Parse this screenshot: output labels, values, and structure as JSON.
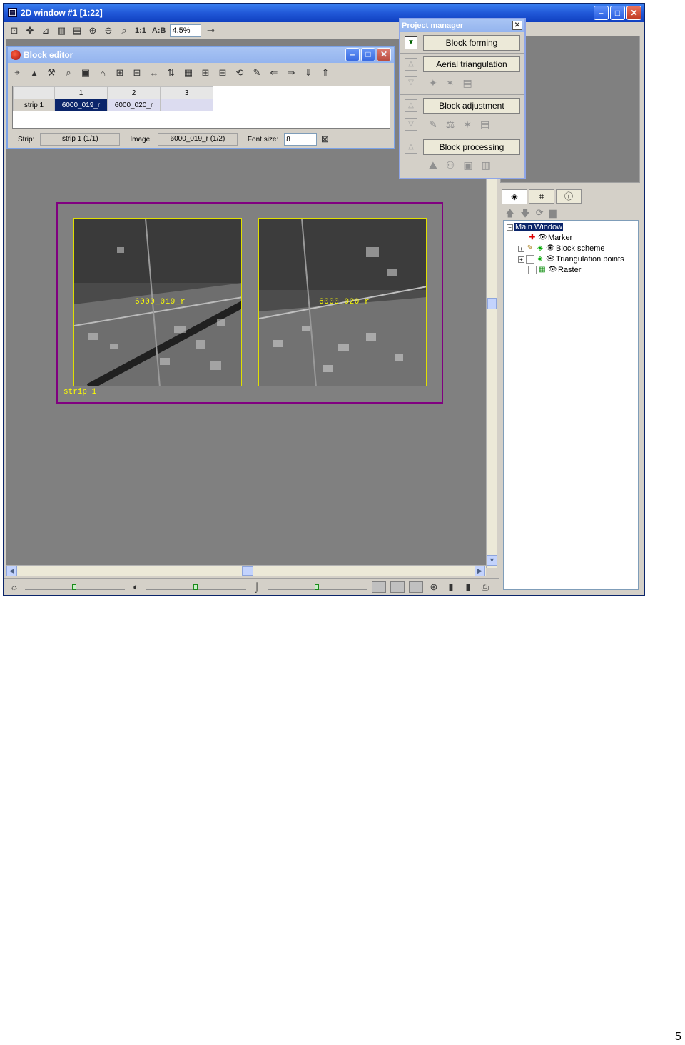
{
  "window": {
    "title": "2D window #1 [1:22]",
    "zoom_value": "4.5%",
    "scale_label": "1:1",
    "ab_label": "A:B"
  },
  "block_editor": {
    "title": "Block editor",
    "columns": [
      "1",
      "2",
      "3"
    ],
    "rows": [
      {
        "strip": "strip 1",
        "cells": [
          "6000_019_r",
          "6000_020_r",
          ""
        ]
      }
    ],
    "status": {
      "strip_label": "Strip:",
      "strip_value": "strip 1 (1/1)",
      "image_label": "Image:",
      "image_value": "6000_019_r (1/2)",
      "font_size_label": "Font size:",
      "font_size_value": "8"
    }
  },
  "project_manager": {
    "title": "Project manager",
    "steps": [
      "Block forming",
      "Aerial triangulation",
      "Block adjustment",
      "Block processing"
    ]
  },
  "scheme": {
    "strip_label": "strip 1",
    "images": [
      "6000_019_r",
      "6000_020_r"
    ]
  },
  "tree": {
    "root": "Main Window",
    "items": [
      "Marker",
      "Block scheme",
      "Triangulation points",
      "Raster"
    ]
  },
  "page_number": "5",
  "icons": {
    "photo_tint": "#9a9a9a",
    "frame_color": "#800080",
    "label_color": "#ffff00"
  }
}
